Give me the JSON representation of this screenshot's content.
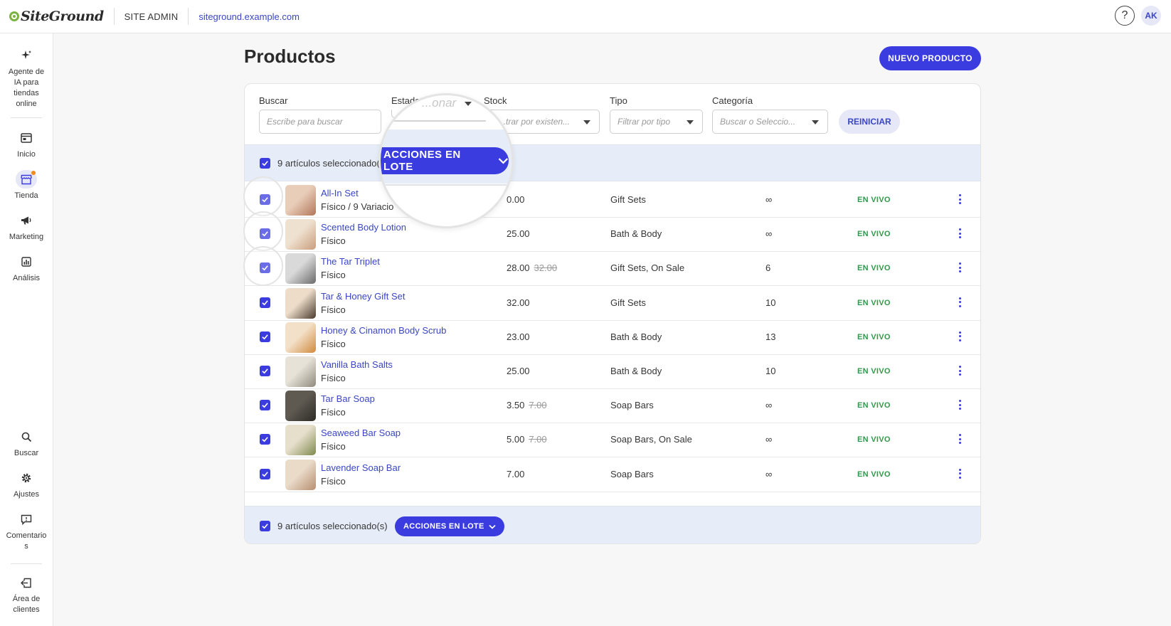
{
  "header": {
    "brand": "SiteGround",
    "section": "SITE ADMIN",
    "site_url": "siteground.example.com",
    "help_icon": "question-icon",
    "avatar_initials": "AK"
  },
  "sidebar": {
    "items": [
      {
        "label": "Agente de IA para tiendas online",
        "icon": "sparkle-icon"
      },
      {
        "label": "Inicio",
        "icon": "dashboard-icon"
      },
      {
        "label": "Tienda",
        "icon": "store-icon",
        "active": true
      },
      {
        "label": "Marketing",
        "icon": "megaphone-icon"
      },
      {
        "label": "Análisis",
        "icon": "chart-icon"
      },
      {
        "label": "Buscar",
        "icon": "search-icon"
      },
      {
        "label": "Ajustes",
        "icon": "gear-icon"
      },
      {
        "label": "Comentarios",
        "icon": "comment-icon"
      },
      {
        "label": "Área de clientes",
        "icon": "exit-icon"
      }
    ]
  },
  "page": {
    "title": "Productos",
    "new_product_label": "NUEVO PRODUCTO"
  },
  "filters": {
    "search_label": "Buscar",
    "search_placeholder": "Escribe para buscar",
    "estado_label": "Estado",
    "estado_placeholder": "...onar",
    "stock_label": "Stock",
    "stock_placeholder": "...trar por existen...",
    "tipo_label": "Tipo",
    "tipo_placeholder": "Filtrar por tipo",
    "categoria_label": "Categoría",
    "categoria_placeholder": "Buscar o Seleccio...",
    "reset_label": "REINICIAR"
  },
  "bulk": {
    "selected_text_top": "9 artículos seleccionado(",
    "selected_text_bottom": "9 artículos seleccionado(s)",
    "actions_label": "ACCIONES EN LOTE"
  },
  "products": [
    {
      "name": "All-In Set",
      "type": "Físico / 9 Variacio",
      "price": "0.00",
      "old_price": "",
      "category": "Gift Sets",
      "stock": "∞",
      "status": "EN VIVO"
    },
    {
      "name": "Scented Body Lotion",
      "type": "Físico",
      "price": "25.00",
      "old_price": "",
      "category": "Bath & Body",
      "stock": "∞",
      "status": "EN VIVO"
    },
    {
      "name": "The Tar Triplet",
      "type": "Físico",
      "price": "28.00",
      "old_price": "32.00",
      "category": "Gift Sets, On Sale",
      "stock": "6",
      "status": "EN VIVO"
    },
    {
      "name": "Tar & Honey Gift Set",
      "type": "Físico",
      "price": "32.00",
      "old_price": "",
      "category": "Gift Sets",
      "stock": "10",
      "status": "EN VIVO"
    },
    {
      "name": "Honey & Cinamon Body Scrub",
      "type": "Físico",
      "price": "23.00",
      "old_price": "",
      "category": "Bath & Body",
      "stock": "13",
      "status": "EN VIVO"
    },
    {
      "name": "Vanilla Bath Salts",
      "type": "Físico",
      "price": "25.00",
      "old_price": "",
      "category": "Bath & Body",
      "stock": "10",
      "status": "EN VIVO"
    },
    {
      "name": "Tar Bar Soap",
      "type": "Físico",
      "price": "3.50",
      "old_price": "7.00",
      "category": "Soap Bars",
      "stock": "∞",
      "status": "EN VIVO"
    },
    {
      "name": "Seaweed Bar Soap",
      "type": "Físico",
      "price": "5.00",
      "old_price": "7.00",
      "category": "Soap Bars, On Sale",
      "stock": "∞",
      "status": "EN VIVO"
    },
    {
      "name": "Lavender Soap Bar",
      "type": "Físico",
      "price": "7.00",
      "old_price": "",
      "category": "Soap Bars",
      "stock": "∞",
      "status": "EN VIVO"
    }
  ],
  "colors": {
    "accent": "#3a3ce0",
    "link": "#3a46c6",
    "live": "#2e9a4a",
    "bulk_bg": "#e6edf8"
  }
}
